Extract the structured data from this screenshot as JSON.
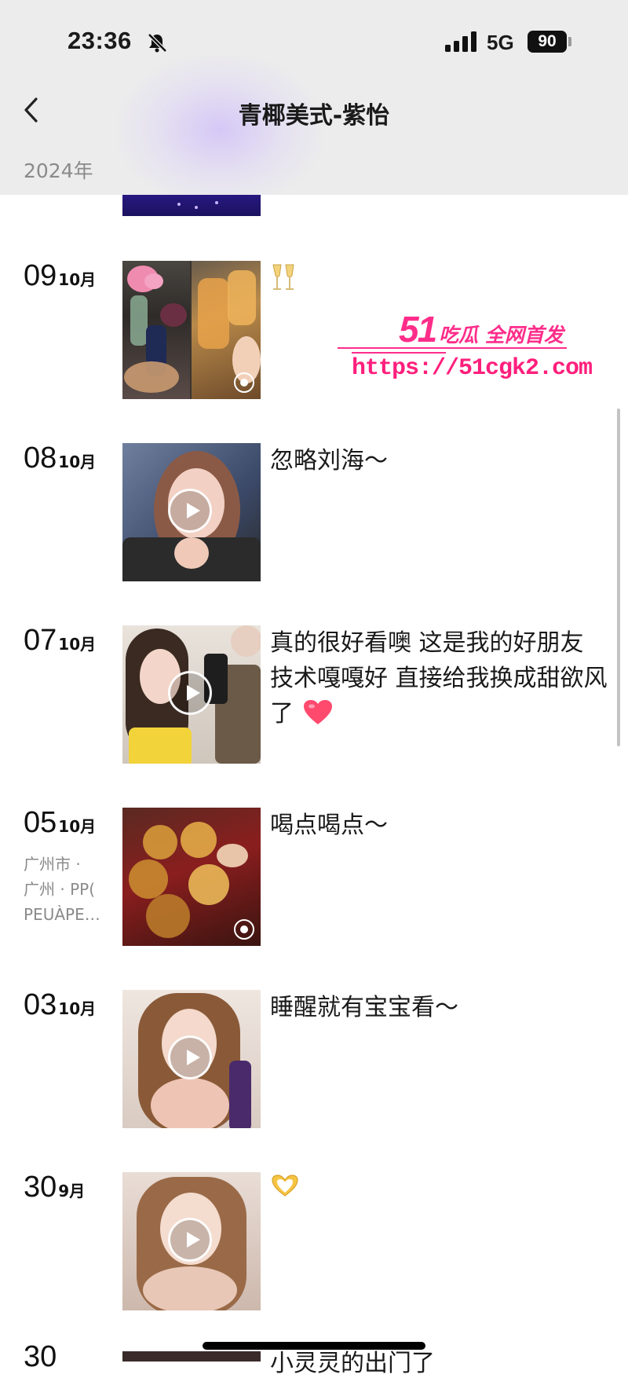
{
  "status_bar": {
    "time": "23:36",
    "network": "5G",
    "battery": "90"
  },
  "header": {
    "title": "青椰美式-紫怡",
    "year_label": "2024年"
  },
  "posts": [
    {
      "day": "09",
      "month": "10月",
      "caption": "",
      "emoji": "champagne-glasses",
      "media": "photo-gallery"
    },
    {
      "day": "08",
      "month": "10月",
      "caption": "忽略刘海～",
      "media": "video"
    },
    {
      "day": "07",
      "month": "10月",
      "caption": "真的很好看噢 这是我的好朋友 技术嘎嘎好 直接给我换成甜欲风了",
      "emoji": "red-heart",
      "media": "video"
    },
    {
      "day": "05",
      "month": "10月",
      "caption": "喝点喝点～",
      "location": [
        "广州市 ·",
        "广州 · PP(",
        "PEUÀPE…"
      ],
      "media": "photo-gallery"
    },
    {
      "day": "03",
      "month": "10月",
      "caption": "睡醒就有宝宝看～",
      "media": "video"
    },
    {
      "day": "30",
      "month": "9月",
      "caption": "",
      "emoji": "heart-hands",
      "media": "video"
    }
  ],
  "next_post_peek": {
    "day": "30",
    "caption": "小灵灵的出门了"
  },
  "watermark": {
    "brand_number": "51",
    "brand_tag": "吃瓜 全网首发",
    "url": "https://51cgk2.com"
  },
  "colors": {
    "header_bg": "#ececec",
    "watermark": "#ff2d8a",
    "meta_text": "#8a8a8a",
    "heart": "#ff4a6e"
  }
}
